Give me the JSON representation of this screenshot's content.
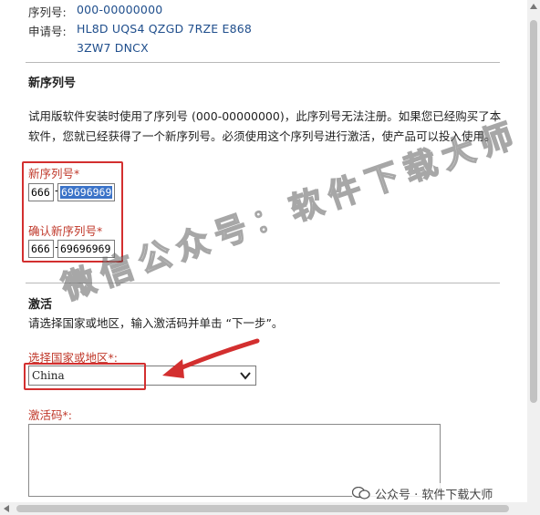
{
  "info": {
    "serial_label": "序列号:",
    "serial_value": "000-00000000",
    "request_label": "申请号:",
    "request_line1": "HL8D UQS4 QZGD 7RZE E868",
    "request_line2": "3ZW7 DNCX"
  },
  "new_serial": {
    "title": "新序列号",
    "description": "试用版软件安装时使用了序列号 (000-00000000)，此序列号无法注册。如果您已经购买了本软件，您就已经获得了一个新序列号。必须使用这个序列号进行激活，使产品可以投入使用。",
    "new_label": "新序列号*",
    "new_prefix": "666",
    "new_suffix": "69696969",
    "confirm_label": "确认新序列号*",
    "confirm_prefix": "666",
    "confirm_suffix": "69696969",
    "dash": "-"
  },
  "activation": {
    "title": "激活",
    "instruction": "请选择国家或地区，输入激活码并单击 “下一步”。",
    "country_label": "选择国家或地区*:",
    "country_value": "China",
    "code_label": "激活码*:"
  },
  "watermark": {
    "text": "微信公众号：软件下载大师",
    "corner_text": "公众号 · 软件下载大师"
  },
  "colors": {
    "highlight_red": "#d32f2f",
    "link_blue": "#1f4e8c",
    "selection_blue": "#3b73c8"
  }
}
